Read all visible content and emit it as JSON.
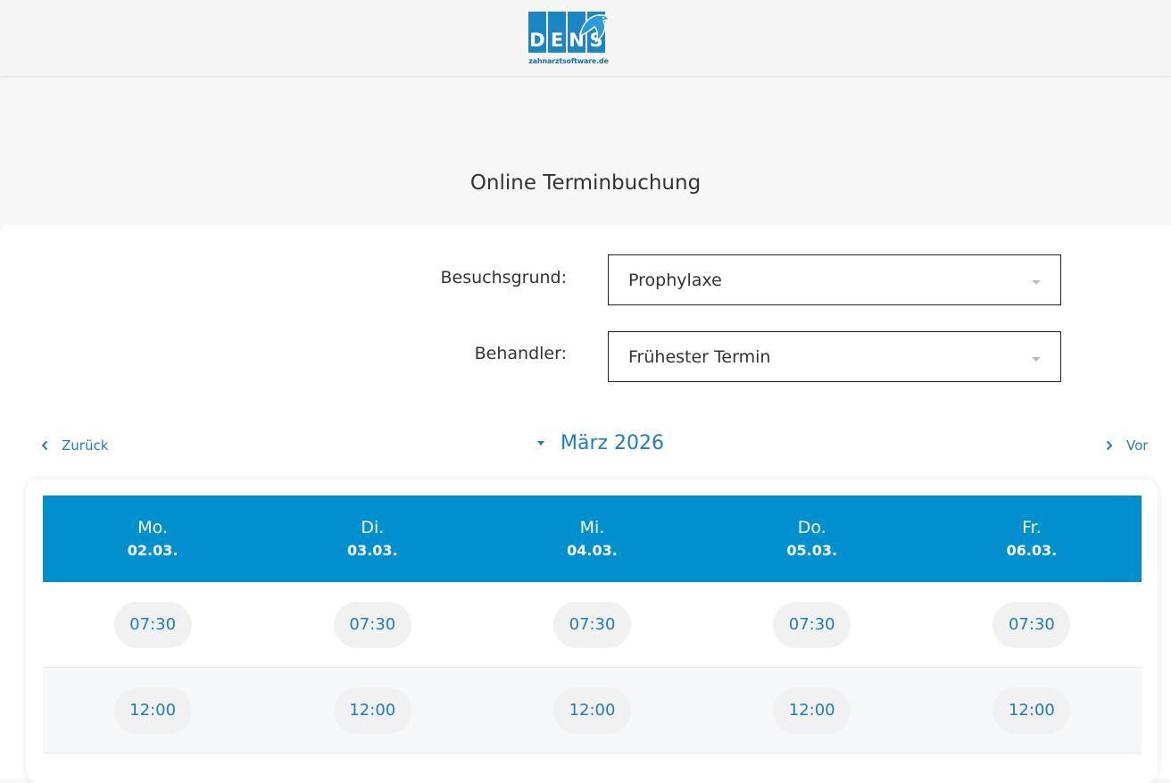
{
  "brand": {
    "logo_letters": [
      "D",
      "E",
      "N",
      "S"
    ],
    "logo_subtitle": "zahnarztsoftware.de",
    "color": "#1a86c6"
  },
  "page": {
    "title": "Online Terminbuchung"
  },
  "form": {
    "reason_label": "Besuchsgrund:",
    "reason_value": "Prophylaxe",
    "provider_label": "Behandler:",
    "provider_value": "Frühester Termin"
  },
  "calendar_nav": {
    "prev_label": "Zurück",
    "next_label": "Vor",
    "month_label": "März 2026",
    "accent_color": "#1c7ec0"
  },
  "calendar": {
    "header_color": "#0090cf",
    "days": [
      {
        "name": "Mo.",
        "date": "02.03."
      },
      {
        "name": "Di.",
        "date": "03.03."
      },
      {
        "name": "Mi.",
        "date": "04.03."
      },
      {
        "name": "Do.",
        "date": "05.03."
      },
      {
        "name": "Fr.",
        "date": "06.03."
      }
    ],
    "rows": [
      {
        "slots": [
          "07:30",
          "07:30",
          "07:30",
          "07:30",
          "07:30"
        ]
      },
      {
        "slots": [
          "12:00",
          "12:00",
          "12:00",
          "12:00",
          "12:00"
        ]
      }
    ]
  }
}
